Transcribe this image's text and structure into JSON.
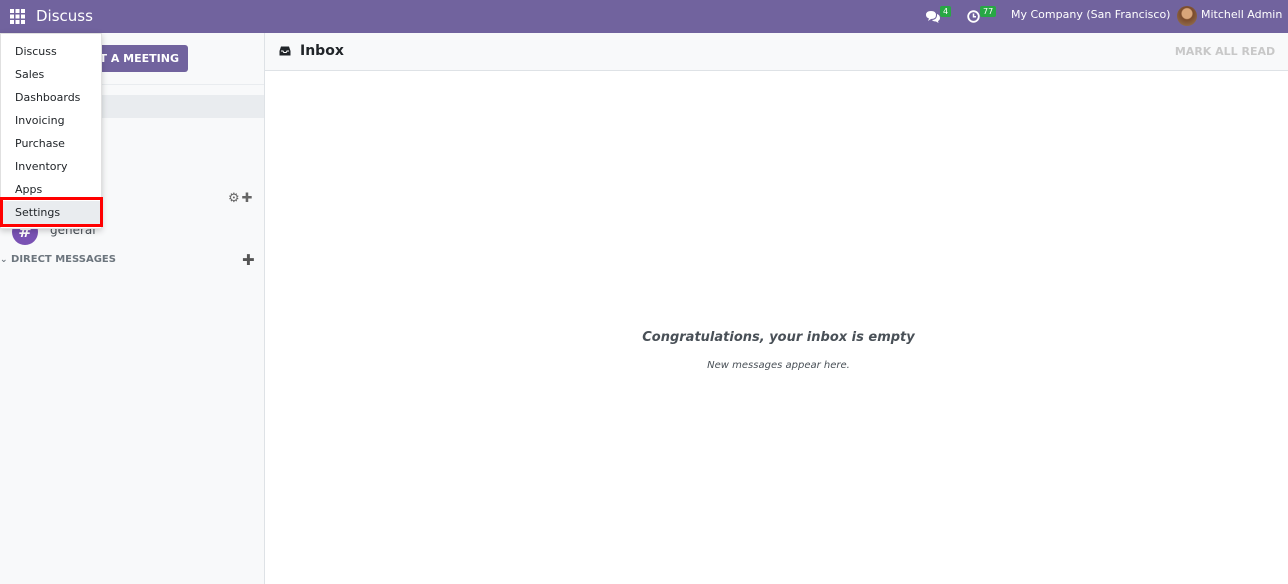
{
  "navbar": {
    "app_title": "Discuss",
    "messages_badge": "4",
    "activities_badge": "77",
    "company": "My Company (San Francisco)",
    "user_name": "Mitchell Admin"
  },
  "sidebar": {
    "start_meeting_label": "RT A MEETING",
    "channel_name": "general",
    "channel_avatar": "#",
    "direct_messages_label": "DIRECT MESSAGES"
  },
  "main": {
    "title": "Inbox",
    "mark_all_read_label": "MARK ALL READ",
    "empty_title": "Congratulations, your inbox is empty",
    "empty_subtitle": "New messages appear here."
  },
  "apps_menu": {
    "items": [
      {
        "label": "Discuss"
      },
      {
        "label": "Sales"
      },
      {
        "label": "Dashboards"
      },
      {
        "label": "Invoicing"
      },
      {
        "label": "Purchase"
      },
      {
        "label": "Inventory"
      },
      {
        "label": "Apps"
      },
      {
        "label": "Settings"
      }
    ],
    "highlighted_item": "Settings"
  },
  "colors": {
    "brand": "#71639e",
    "badge": "#28a745",
    "highlight": "#ff0000",
    "channel_avatar": "#7952b3"
  }
}
